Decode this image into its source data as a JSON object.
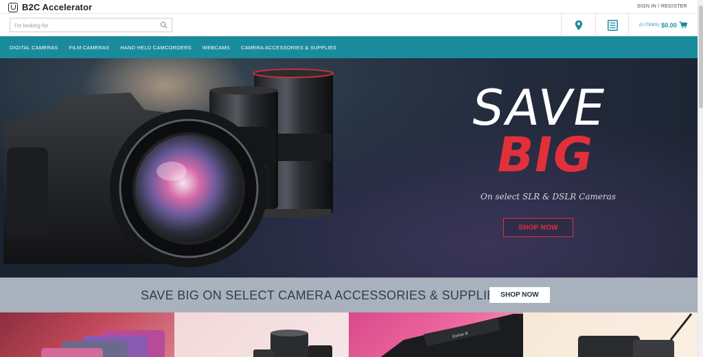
{
  "brand": {
    "name": "B2C Accelerator"
  },
  "header": {
    "signin_label": "SIGN IN / REGISTER"
  },
  "search": {
    "placeholder": "I'm looking for"
  },
  "cart": {
    "items_label": "(0 ITEMS)",
    "total": "$0.00"
  },
  "nav": {
    "items": [
      {
        "label": "DIGITAL CAMERAS"
      },
      {
        "label": "FILM CAMERAS"
      },
      {
        "label": "HAND HELD CAMCORDERS"
      },
      {
        "label": "WEBCAMS"
      },
      {
        "label": "CAMERA ACCESSORIES & SUPPLIES"
      }
    ]
  },
  "hero": {
    "title_line1": "SAVE",
    "title_line2": "BIG",
    "subtitle": "On select SLR & DSLR Cameras",
    "button_label": "SHOP NOW"
  },
  "promo": {
    "text": "SAVE BIG ON SELECT CAMERA ACCESSORIES & SUPPLIES",
    "button_label": "SHOP NOW"
  },
  "colors": {
    "accent": "#1a8b9d",
    "hero_red": "#e2303b",
    "promo_bg": "#a9b1bc"
  }
}
